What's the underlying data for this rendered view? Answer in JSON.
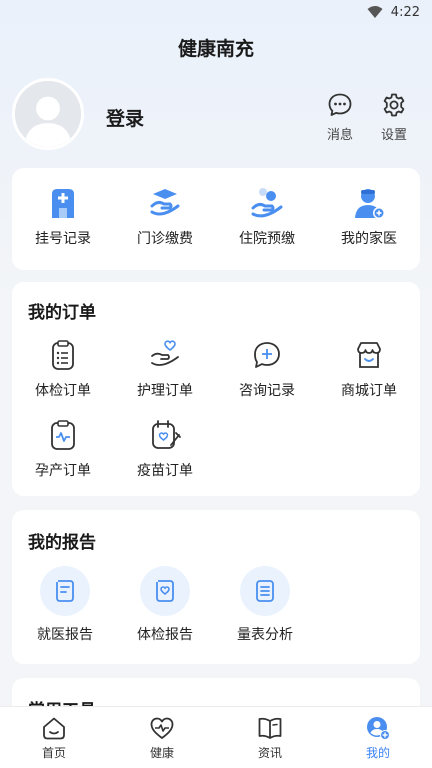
{
  "status_bar": {
    "time": "4:22"
  },
  "header": {
    "title": "健康南充"
  },
  "profile": {
    "login_label": "登录",
    "messages_label": "消息",
    "settings_label": "设置"
  },
  "quick_services": [
    {
      "label": "挂号记录",
      "icon": "hospital-icon"
    },
    {
      "label": "门诊缴费",
      "icon": "payment-hand-icon"
    },
    {
      "label": "住院预缴",
      "icon": "hand-coins-icon"
    },
    {
      "label": "我的家医",
      "icon": "family-doctor-icon"
    }
  ],
  "orders": {
    "title": "我的订单",
    "items": [
      {
        "label": "体检订单",
        "icon": "checklist-icon"
      },
      {
        "label": "护理订单",
        "icon": "care-hand-icon"
      },
      {
        "label": "咨询记录",
        "icon": "consult-plus-icon"
      },
      {
        "label": "商城订单",
        "icon": "store-icon"
      },
      {
        "label": "孕产订单",
        "icon": "pregnancy-clipboard-icon"
      },
      {
        "label": "疫苗订单",
        "icon": "vaccine-calendar-icon"
      }
    ]
  },
  "reports": {
    "title": "我的报告",
    "items": [
      {
        "label": "就医报告",
        "icon": "medical-report-icon"
      },
      {
        "label": "体检报告",
        "icon": "checkup-report-icon"
      },
      {
        "label": "量表分析",
        "icon": "scale-analysis-icon"
      }
    ]
  },
  "tools": {
    "title": "常用工具"
  },
  "tabbar": [
    {
      "label": "首页",
      "icon": "home-icon",
      "active": false
    },
    {
      "label": "健康",
      "icon": "heart-pulse-icon",
      "active": false
    },
    {
      "label": "资讯",
      "icon": "book-icon",
      "active": false
    },
    {
      "label": "我的",
      "icon": "user-icon",
      "active": true
    }
  ],
  "colors": {
    "accent": "#3b82f6",
    "accent_light": "#eaf2fd"
  }
}
